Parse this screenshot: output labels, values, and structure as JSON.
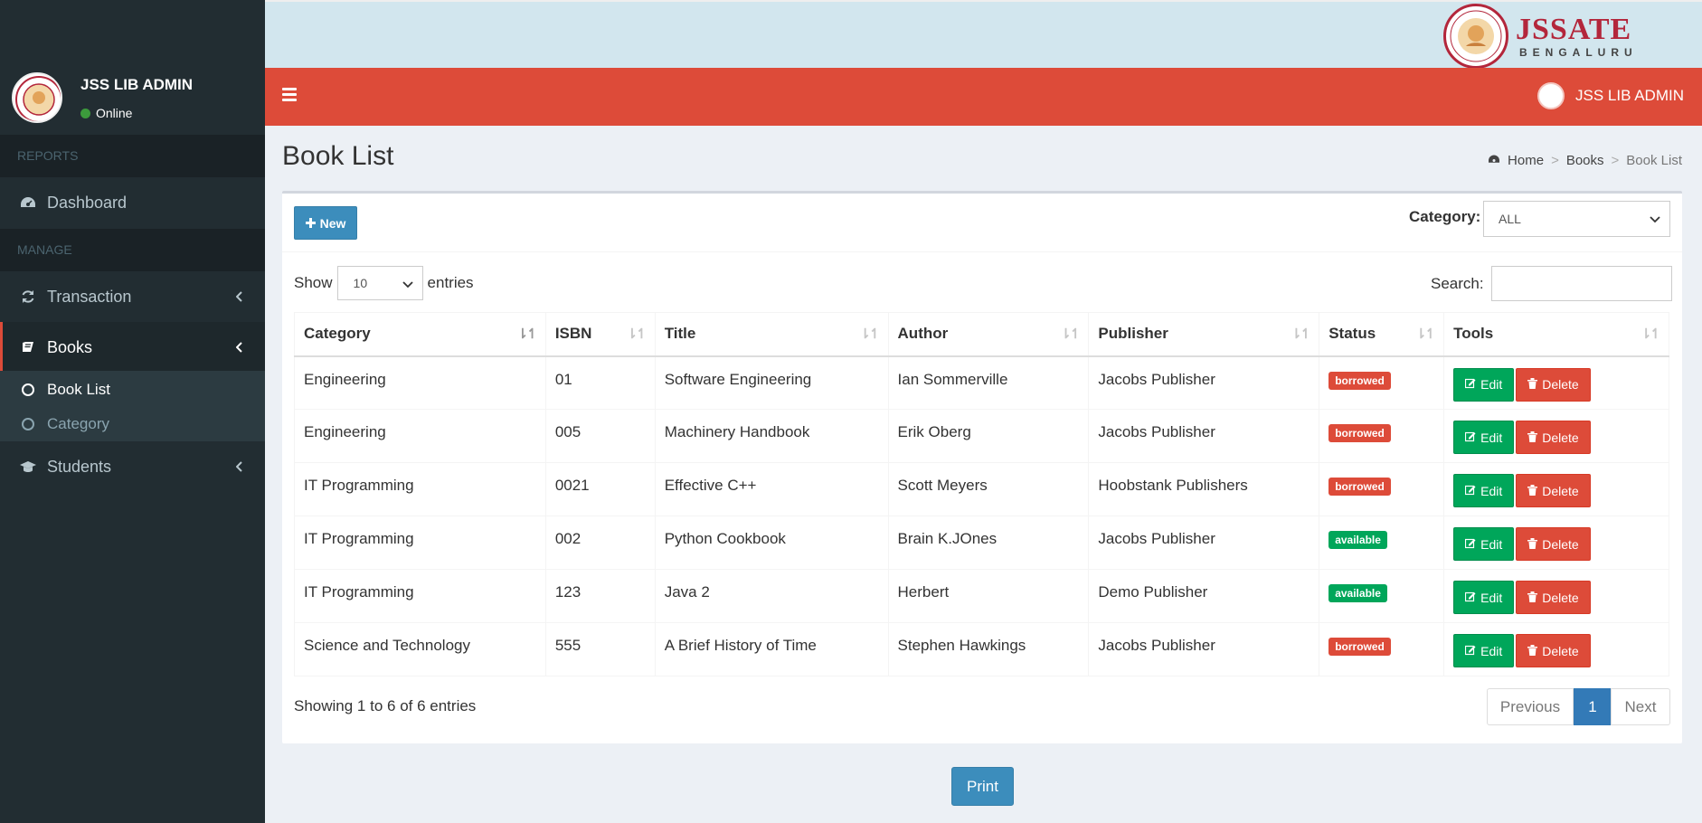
{
  "user": {
    "name": "JSS LIB ADMIN",
    "status": "Online"
  },
  "brand": {
    "title": "JSSATE",
    "subtitle": "BENGALURU"
  },
  "sidebar": {
    "headers": [
      "REPORTS",
      "MANAGE"
    ],
    "items": [
      {
        "label": "Dashboard",
        "icon": "dashboard-icon"
      },
      {
        "label": "Transaction",
        "icon": "refresh-icon"
      },
      {
        "label": "Books",
        "icon": "book-icon"
      },
      {
        "label": "Students",
        "icon": "graduation-cap-icon"
      }
    ],
    "sub_items": [
      {
        "label": "Book List"
      },
      {
        "label": "Category"
      }
    ]
  },
  "navbar": {
    "user_name": "JSS LIB ADMIN"
  },
  "page": {
    "title": "Book List",
    "breadcrumb": [
      "Home",
      "Books",
      "Book List"
    ]
  },
  "toolbar": {
    "new_label": "New",
    "category_label": "Category:",
    "category_value": "ALL",
    "show_label": "Show",
    "entries_value": "10",
    "entries_label": "entries",
    "search_label": "Search:"
  },
  "table": {
    "columns": [
      "Category",
      "ISBN",
      "Title",
      "Author",
      "Publisher",
      "Status",
      "Tools"
    ],
    "rows": [
      {
        "category": "Engineering",
        "isbn": "01",
        "title": "Software Engineering",
        "author": "Ian Sommerville",
        "publisher": "Jacobs Publisher",
        "status": "borrowed"
      },
      {
        "category": "Engineering",
        "isbn": "005",
        "title": "Machinery Handbook",
        "author": "Erik Oberg",
        "publisher": "Jacobs Publisher",
        "status": "borrowed"
      },
      {
        "category": "IT Programming",
        "isbn": "0021",
        "title": "Effective C++",
        "author": "Scott Meyers",
        "publisher": "Hoobstank Publishers",
        "status": "borrowed"
      },
      {
        "category": "IT Programming",
        "isbn": "002",
        "title": "Python Cookbook",
        "author": "Brain K.JOnes",
        "publisher": "Jacobs Publisher",
        "status": "available"
      },
      {
        "category": "IT Programming",
        "isbn": "123",
        "title": "Java 2",
        "author": "Herbert",
        "publisher": "Demo Publisher",
        "status": "available"
      },
      {
        "category": "Science and Technology",
        "isbn": "555",
        "title": "A Brief History of Time",
        "author": "Stephen Hawkings",
        "publisher": "Jacobs Publisher",
        "status": "borrowed"
      }
    ],
    "edit_label": "Edit",
    "delete_label": "Delete"
  },
  "footer": {
    "info": "Showing 1 to 6 of 6 entries",
    "previous": "Previous",
    "page": "1",
    "next": "Next",
    "print": "Print"
  },
  "colors": {
    "navbar": "#dd4b39",
    "sidebar": "#222d32",
    "primary": "#3c8dbc",
    "success": "#00a65a",
    "danger": "#dd4b39"
  }
}
